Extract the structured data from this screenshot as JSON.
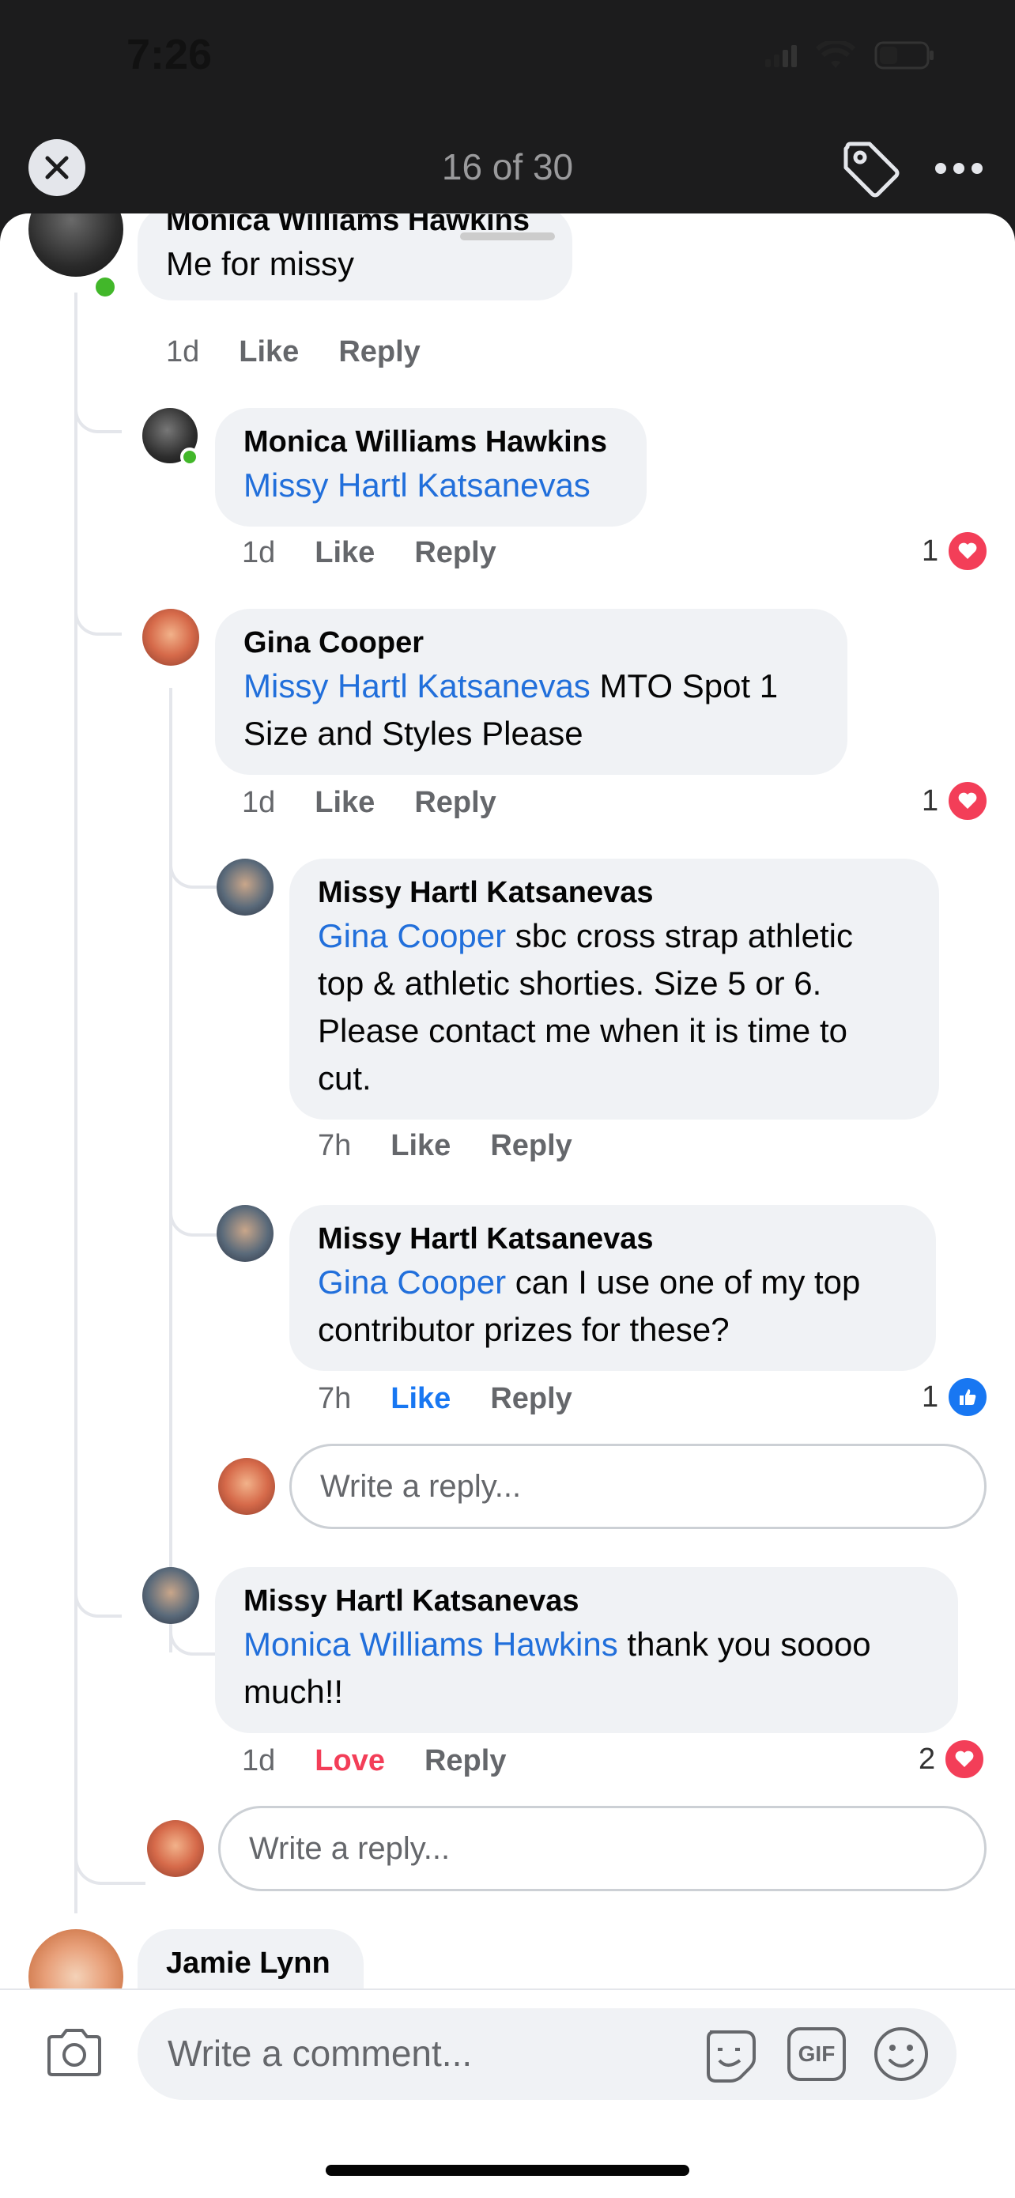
{
  "status_bar": {
    "time": "7:26"
  },
  "header": {
    "counter": "16 of 30"
  },
  "icons": {
    "close": "close-icon",
    "tag": "tag-icon",
    "more": "more-icon",
    "camera": "camera-icon",
    "sticker": "sticker-icon",
    "gif": "gif-icon",
    "emoji": "emoji-icon",
    "heart": "heart-icon",
    "thumb": "thumbs-up-icon"
  },
  "colors": {
    "mention": "#216fdb",
    "love": "#f33e58",
    "like": "#1877f2"
  },
  "actions": {
    "like": "Like",
    "reply": "Reply",
    "love": "Love"
  },
  "comments": [
    {
      "name": "Monica Williams Hawkins",
      "text": "Me for missy",
      "time": "1d"
    },
    {
      "name": "Monica Williams Hawkins",
      "mention": "Missy Hartl Katsanevas",
      "text": "",
      "time": "1d",
      "reactions": "1"
    },
    {
      "name": "Gina Cooper",
      "mention": "Missy Hartl Katsanevas",
      "text_line1": " MTO Spot 1",
      "text_line2": "Size and Styles Please",
      "time": "1d",
      "reactions": "1"
    },
    {
      "name": "Missy Hartl Katsanevas",
      "mention": "Gina Cooper",
      "text_line1": " sbc cross strap athletic",
      "text_line2": "top & athletic shorties. Size 5 or 6.",
      "text_line3": "Please contact me when it is time to",
      "text_line4": "cut.",
      "time": "7h"
    },
    {
      "name": "Missy Hartl Katsanevas",
      "mention": "Gina Cooper",
      "text_line1": " can I use one of my top",
      "text_line2": "contributor prizes for these?",
      "time": "7h",
      "reactions": "1"
    },
    {
      "name": "Missy Hartl Katsanevas",
      "mention": "Monica Williams Hawkins",
      "text_line1": " thank you soooo",
      "text_line2": "much!!",
      "time": "1d",
      "reactions": "2"
    },
    {
      "name": "Jamie Lynn"
    }
  ],
  "reply_placeholder": "Write a reply...",
  "comment_placeholder": "Write a comment...",
  "gif_label": "GIF"
}
